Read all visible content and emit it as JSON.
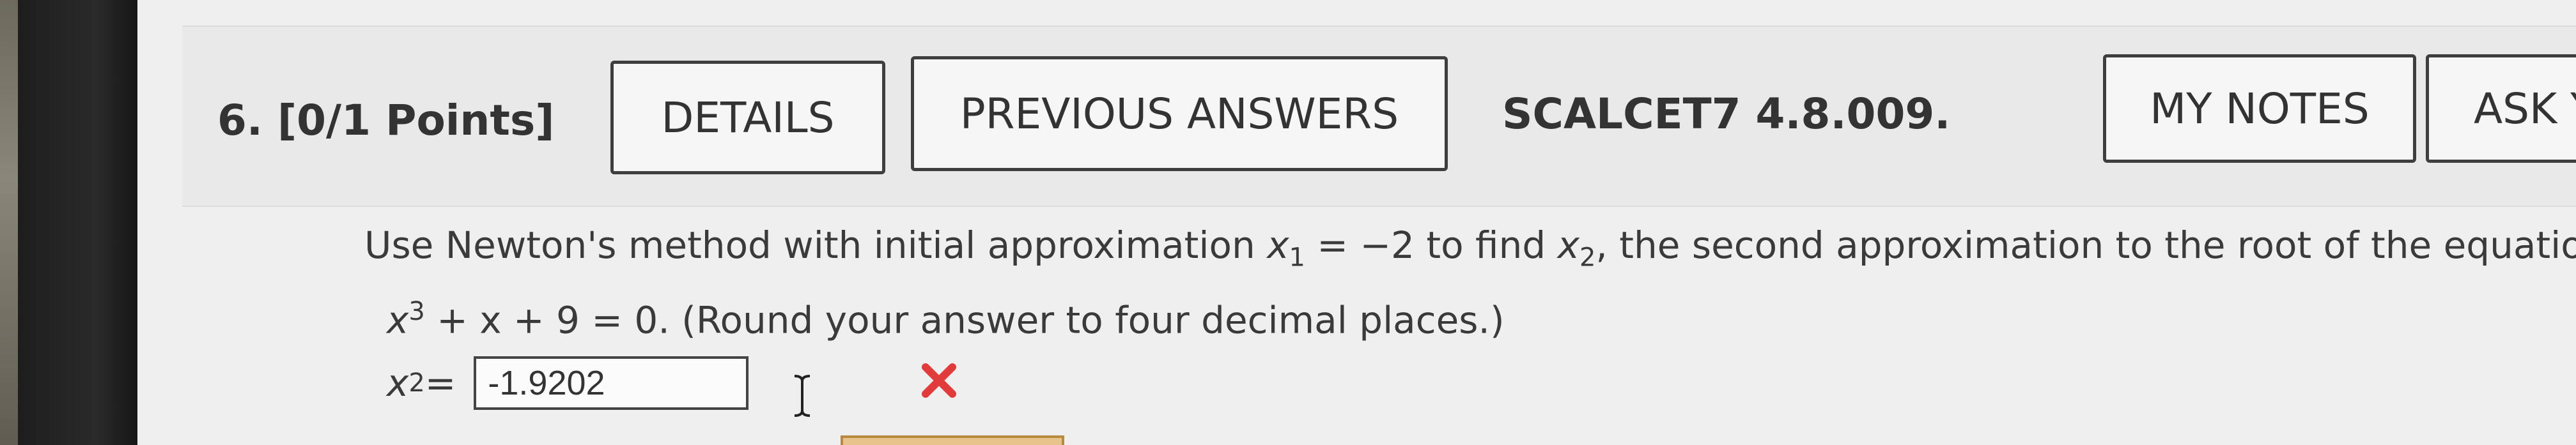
{
  "question": {
    "number_label": "6. [0/1 Points]",
    "buttons": {
      "details": "DETAILS",
      "previous_answers": "PREVIOUS ANSWERS",
      "my_notes": "MY NOTES",
      "ask": "ASK Y"
    },
    "problem_code": "SCALCET7 4.8.009."
  },
  "problem": {
    "line1_a": "Use Newton's method with initial approximation ",
    "x1_var": "x",
    "x1_sub": "1",
    "line1_b": " = −2 to find ",
    "x2_var": "x",
    "x2_sub": "2",
    "line1_c": ", the second approximation to the root of the equation",
    "line2_x": "x",
    "line2_sup": "3",
    "line2_rest": " + x + 9 = 0. (Round your answer to four decimal places.)"
  },
  "answer": {
    "label_var": "x",
    "label_sub": "2",
    "label_eq": " =",
    "value": "-1.9202",
    "status": "incorrect"
  },
  "colors": {
    "incorrect_mark": "#e23b3b",
    "button_border": "#3e3e3e"
  },
  "icons": {
    "wrong": "x-mark-icon",
    "cursor": "text-cursor-icon"
  }
}
